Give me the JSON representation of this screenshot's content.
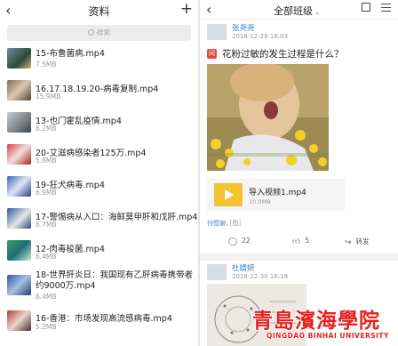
{
  "left": {
    "header": {
      "back": "‹",
      "title": "资料",
      "add": "+"
    },
    "search": {
      "placeholder": "搜索"
    },
    "files": [
      {
        "name": "15-布鲁菌病.mp4",
        "size": "7.5MB"
      },
      {
        "name": "16.17.18.19.20-病毒复制.mp4",
        "size": "15.9MB"
      },
      {
        "name": "13-也门霍乱疫情.mp4",
        "size": "6.2MB"
      },
      {
        "name": "20-艾滋病感染者125万.mp4",
        "size": "5.8MB"
      },
      {
        "name": "19-狂犬病毒.mp4",
        "size": "6.9MB"
      },
      {
        "name": "17-警惕病从入口：海鲜莫甲肝和戊肝.mp4",
        "size": "6.7MB"
      },
      {
        "name": "12-肉毒梭菌.mp4",
        "size": "6.4MB"
      },
      {
        "name": "18-世界肝炎日：我国现有乙肝病毒携带者约9000万.mp4",
        "size": "6.4MB"
      },
      {
        "name": "16-香港：市场发现高流感病毒.mp4",
        "size": "5.2MB"
      }
    ]
  },
  "right": {
    "header": {
      "back": "‹",
      "title": "全部班级",
      "chevron": "⌄"
    },
    "post1": {
      "user": "张尧尧",
      "date": "2018-12-28 16:03",
      "tag": "问",
      "question": "花粉过敏的发生过程是什么？",
      "video_name": "导入视频1.mp4",
      "video_size": "10.0MB",
      "attach_label": "付图谢:",
      "attach_value": "[图]",
      "comments": "22",
      "likes": "5",
      "share": "转发"
    },
    "post2": {
      "user": "杜婧妍",
      "date": "2018-12-30 16:18"
    }
  },
  "watermark": {
    "cn": "青島濱海學院",
    "en": "QINGDAO BINHAI UNIVERSITY"
  },
  "colors": {
    "accent": "#3d7fc4",
    "play": "#f3c231",
    "tag": "#e24b3a",
    "watermark": "#e62020"
  }
}
